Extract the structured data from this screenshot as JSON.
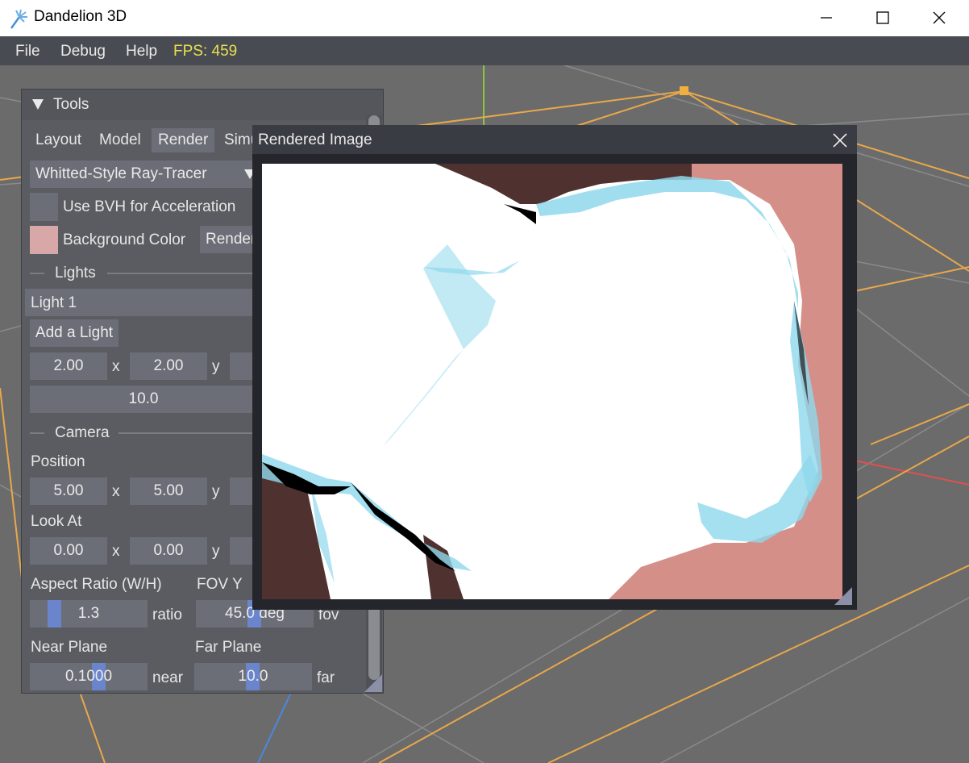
{
  "window": {
    "title": "Dandelion 3D",
    "app_icon": "dandelion-icon",
    "controls": [
      "minimize-icon",
      "maximize-icon",
      "close-icon"
    ]
  },
  "menu": {
    "items": [
      "File",
      "Debug",
      "Help"
    ],
    "fps": "FPS: 459"
  },
  "tools": {
    "title": "Tools",
    "tabs": [
      "Layout",
      "Model",
      "Render",
      "Simu"
    ],
    "active_tab": "Render",
    "renderer": "Whitted-Style Ray-Tracer",
    "use_bvh_label": "Use BVH for Acceleration",
    "use_bvh_checked": false,
    "background_color_label": "Background Color",
    "background_color": "#d8a8a8",
    "render_button": "Render",
    "lights_header": "Lights",
    "light_item": "Light 1",
    "add_light": "Add a Light",
    "light_x": "2.00",
    "light_y": "2.00",
    "light_x_label": "x",
    "light_y_label": "y",
    "light_intensity": "10.0",
    "camera_header": "Camera",
    "position_label": "Position",
    "pos_x": "5.00",
    "pos_y": "5.00",
    "pos_x_label": "x",
    "pos_y_label": "y",
    "lookat_label": "Look At",
    "look_x": "0.00",
    "look_y": "0.00",
    "look_x_label": "x",
    "look_y_label": "y",
    "aspect_label": "Aspect Ratio (W/H)",
    "aspect_value": "1.3",
    "aspect_unit": "ratio",
    "fov_label": "FOV Y",
    "fov_value": "45.0 deg",
    "fov_unit": "fov",
    "near_label": "Near Plane",
    "near_value": "0.1000",
    "near_unit": "near",
    "far_label": "Far Plane",
    "far_value": "10.0",
    "far_unit": "far"
  },
  "render_window": {
    "title": "Rendered Image",
    "close_icon": "close-icon",
    "background_color": "#d49088"
  }
}
